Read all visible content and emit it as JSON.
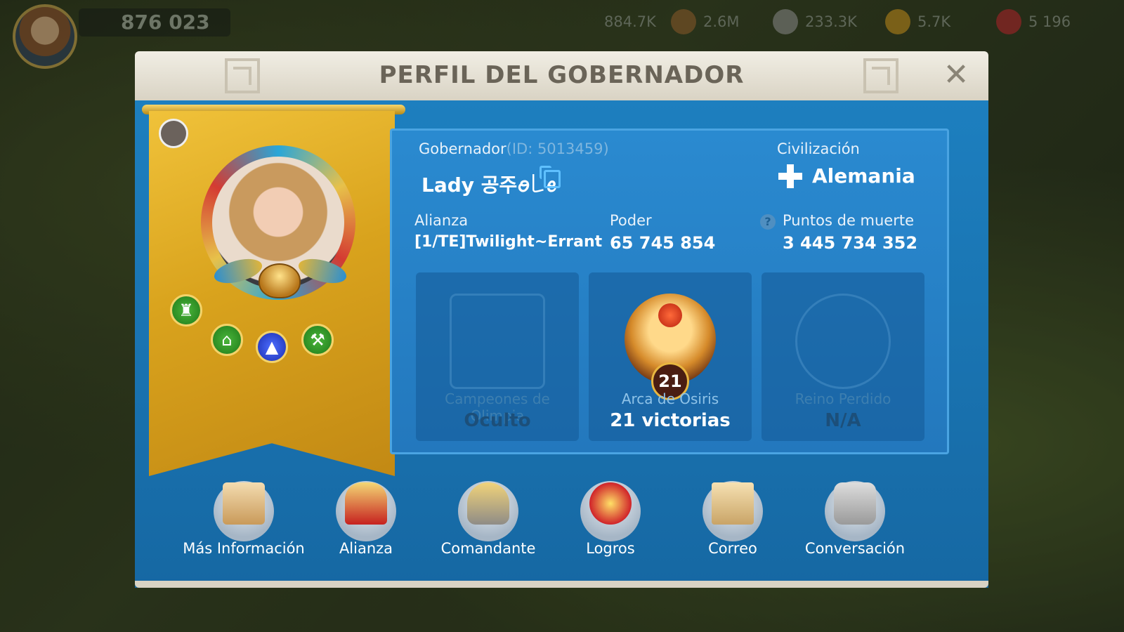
{
  "hud": {
    "power": "876 023",
    "resources": [
      "884.7K",
      "2.6M",
      "233.3K",
      "5.7K",
      "5 196"
    ]
  },
  "panel": {
    "title": "PERFIL DEL GOBERNADOR",
    "close_icon": "close-icon"
  },
  "governor": {
    "label": "Gobernador",
    "id_text": "(ID: 5013459)",
    "name": "Lady 공주ꪮ꒒ꫀ",
    "civ_label": "Civilización",
    "civ_value": "Alemania",
    "alliance_label": "Alianza",
    "alliance_value": "[1/TE]Twilight~Errant",
    "power_label": "Poder",
    "power_value": "65 745 854",
    "death_label": "Puntos de muerte",
    "death_value": "3 445 734 352"
  },
  "tiles": [
    {
      "name": "Campeones de Olimpia",
      "value": "Oculto",
      "icon": "olympia-arena-icon"
    },
    {
      "name": "Arca de Osiris",
      "value": "21 victorias",
      "icon": "osiris-eagle-icon",
      "badge": "21"
    },
    {
      "name": "Reino Perdido",
      "value": "N/A",
      "icon": "lost-kingdom-swords-icon"
    }
  ],
  "actions": [
    {
      "label": "Más Información",
      "icon": "scroll-icon"
    },
    {
      "label": "Alianza",
      "icon": "alliance-sword-icon"
    },
    {
      "label": "Comandante",
      "icon": "commander-helmet-icon"
    },
    {
      "label": "Logros",
      "icon": "achievement-laurel-icon"
    },
    {
      "label": "Correo",
      "icon": "mail-icon"
    },
    {
      "label": "Conversación",
      "icon": "chat-icon"
    }
  ],
  "colors": {
    "panel_blue": "#1d7fbf",
    "banner_gold": "#d9a31d",
    "title_text": "#6a6458"
  }
}
